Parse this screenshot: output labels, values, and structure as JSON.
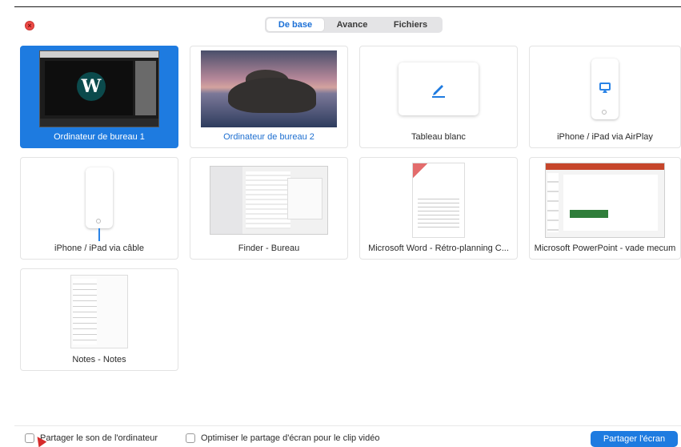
{
  "tabs": [
    {
      "label": "De base",
      "active": true
    },
    {
      "label": "Avance",
      "active": false
    },
    {
      "label": "Fichiers",
      "active": false
    }
  ],
  "sources": [
    {
      "label": "Ordinateur de bureau 1",
      "kind": "desktop",
      "selected": true,
      "logo_text": "W"
    },
    {
      "label": "Ordinateur de bureau 2",
      "kind": "desktop-wallpaper",
      "selected": false
    },
    {
      "label": "Tableau blanc",
      "kind": "whiteboard",
      "selected": false,
      "icon": "pen-icon"
    },
    {
      "label": "iPhone / iPad via AirPlay",
      "kind": "airplay",
      "selected": false,
      "icon": "airplay-icon"
    },
    {
      "label": "iPhone / iPad via câble",
      "kind": "cable",
      "selected": false,
      "icon": "phone-cable-icon"
    },
    {
      "label": "Finder - Bureau",
      "kind": "window",
      "selected": false
    },
    {
      "label": "Microsoft Word - Rétro-planning C...",
      "kind": "window",
      "selected": false
    },
    {
      "label": "Microsoft PowerPoint - vade mecum",
      "kind": "window",
      "selected": false
    },
    {
      "label": "Notes - Notes",
      "kind": "window",
      "selected": false
    }
  ],
  "footer": {
    "share_sound_label": "Partager le son de l'ordinateur",
    "optimize_label": "Optimiser le partage d'écran pour le clip vidéo",
    "share_button_label": "Partager l'écran"
  },
  "colors": {
    "accent": "#1e7be0",
    "close": "#ee4b47",
    "pointer_arrow": "#d62b2b"
  }
}
